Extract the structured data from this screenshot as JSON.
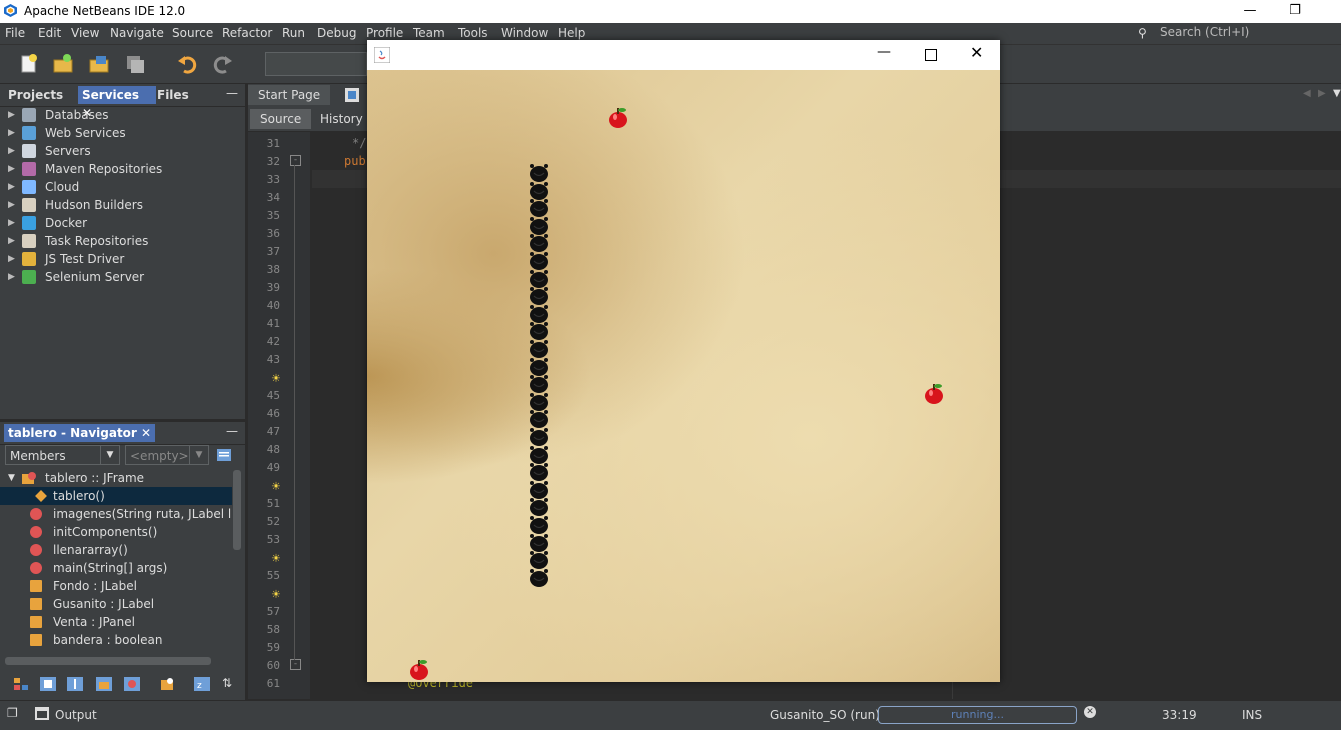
{
  "app": {
    "title": "Apache NetBeans IDE 12.0"
  },
  "menu": [
    "File",
    "Edit",
    "View",
    "Navigate",
    "Source",
    "Refactor",
    "Run",
    "Debug",
    "Profile",
    "Team",
    "Tools",
    "Window",
    "Help"
  ],
  "search": {
    "placeholder": "Search (Ctrl+I)"
  },
  "left_tabs": [
    "Projects",
    "Services",
    "Files"
  ],
  "services": [
    {
      "label": "Databases",
      "icon": "database-icon"
    },
    {
      "label": "Web Services",
      "icon": "web-services-icon"
    },
    {
      "label": "Servers",
      "icon": "servers-icon"
    },
    {
      "label": "Maven Repositories",
      "icon": "maven-icon"
    },
    {
      "label": "Cloud",
      "icon": "cloud-icon"
    },
    {
      "label": "Hudson Builders",
      "icon": "hudson-icon"
    },
    {
      "label": "Docker",
      "icon": "docker-icon"
    },
    {
      "label": "Task Repositories",
      "icon": "task-repo-icon"
    },
    {
      "label": "JS Test Driver",
      "icon": "js-test-icon"
    },
    {
      "label": "Selenium Server",
      "icon": "selenium-icon"
    }
  ],
  "navigator": {
    "title": "tablero - Navigator",
    "members_combo": "Members",
    "filter_combo": "<empty>",
    "root": "tablero :: JFrame",
    "items": [
      {
        "label": "tablero()",
        "icon": "constructor-icon",
        "color": "#e8a33d"
      },
      {
        "label": "imagenes(String ruta, JLabel lug",
        "icon": "method-private-icon",
        "color": "#e05555"
      },
      {
        "label": "initComponents()",
        "icon": "method-private-icon",
        "color": "#e05555"
      },
      {
        "label": "llenararray()",
        "icon": "method-private-icon",
        "color": "#e05555"
      },
      {
        "label": "main(String[] args)",
        "icon": "method-static-icon",
        "color": "#e05555"
      },
      {
        "label": "Fondo : JLabel",
        "icon": "field-icon",
        "color": "#e8a33d"
      },
      {
        "label": "Gusanito : JLabel",
        "icon": "field-icon",
        "color": "#e8a33d"
      },
      {
        "label": "Venta : JPanel",
        "icon": "field-icon",
        "color": "#e8a33d"
      },
      {
        "label": "bandera : boolean",
        "icon": "field-icon",
        "color": "#e8a33d"
      }
    ]
  },
  "editor": {
    "tabs": [
      "Start Page"
    ],
    "subtabs": [
      "Source",
      "History"
    ],
    "line_numbers": [
      "31",
      "32",
      "33",
      "34",
      "35",
      "36",
      "37",
      "38",
      "39",
      "40",
      "41",
      "42",
      "43",
      "",
      "45",
      "46",
      "47",
      "48",
      "49",
      "",
      "51",
      "52",
      "53",
      "",
      "55",
      "",
      "57",
      "58",
      "59",
      "60",
      "61"
    ],
    "code_fragments": {
      "comment_end": "*/",
      "pub": "pub",
      "override": "@Override"
    }
  },
  "status": {
    "output_label": "Output",
    "run_label": "Gusanito_SO (run)",
    "progress_label": "running...",
    "caret": "33:19",
    "mode": "INS"
  },
  "game": {
    "snake_segments": 24,
    "apples": 3
  },
  "colors": {
    "accent": "#4b6eaf",
    "ide_bg": "#3c3f41",
    "editor_bg": "#2b2b2b"
  }
}
